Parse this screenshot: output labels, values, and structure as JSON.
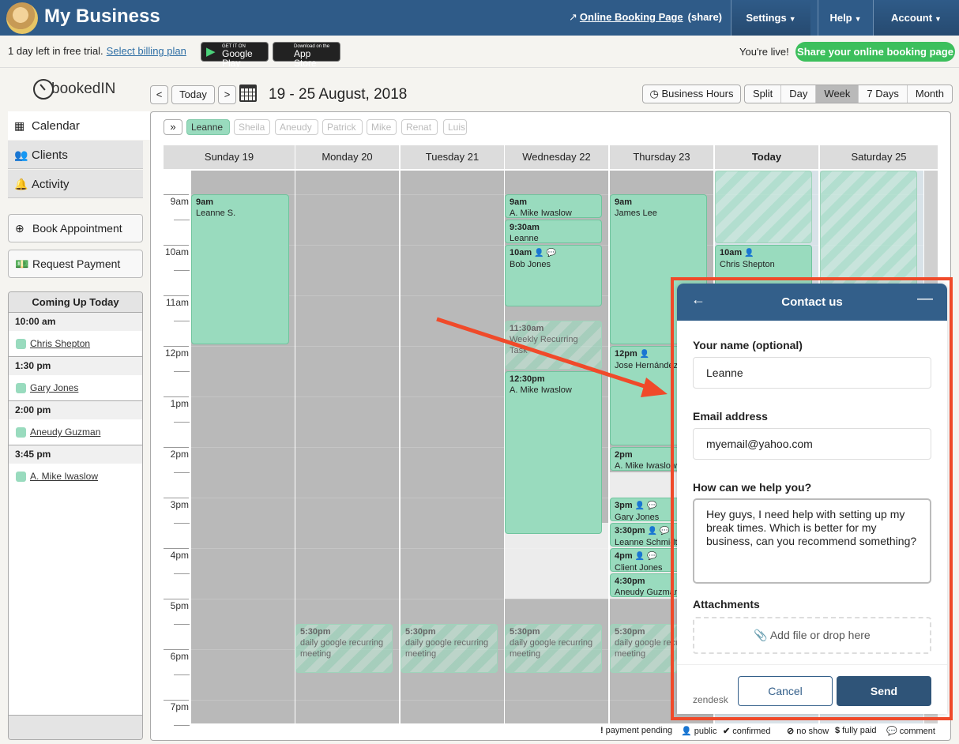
{
  "header": {
    "business_name": "My Business",
    "online_booking_link": "Online Booking Page",
    "share_link": "(share)",
    "nav": [
      {
        "label": "Settings",
        "icon": "caret-down-icon"
      },
      {
        "label": "Help",
        "icon": "caret-down-icon"
      },
      {
        "label": "Account",
        "icon": "caret-down-icon"
      }
    ]
  },
  "trial_bar": {
    "message": "1 day left in free trial.",
    "billing_link": "Select billing plan",
    "google_play": {
      "small": "GET IT ON",
      "big": "Google Play"
    },
    "app_store": {
      "small": "Download on the",
      "big": "App Store"
    },
    "live_text": "You're live!",
    "share_button": "Share your online booking page"
  },
  "toolbar": {
    "logo_text": "bookedIN",
    "prev": "<",
    "today": "Today",
    "next": ">",
    "date_range": "19 - 25 August, 2018",
    "business_hours": "Business Hours",
    "views": [
      "Split",
      "Day",
      "Week",
      "7 Days",
      "Month"
    ],
    "active_view": "Week"
  },
  "sidebar": {
    "nav": [
      {
        "label": "Calendar",
        "icon": "calendar-icon",
        "active": true
      },
      {
        "label": "Clients",
        "icon": "users-icon",
        "active": false
      },
      {
        "label": "Activity",
        "icon": "bell-icon",
        "active": false
      }
    ],
    "book_appointment": "Book Appointment",
    "request_payment": "Request Payment",
    "coming_up": {
      "title": "Coming Up Today",
      "items": [
        {
          "time": "10:00 am",
          "client": "Chris Shepton"
        },
        {
          "time": "1:30 pm",
          "client": "Gary Jones"
        },
        {
          "time": "2:00 pm",
          "client": "Aneudy Guzman"
        },
        {
          "time": "3:45 pm",
          "client": "A. Mike Iwaslow"
        }
      ]
    }
  },
  "calendar": {
    "expand": "»",
    "staff": [
      {
        "name": "Leanne",
        "selected": true
      },
      {
        "name": "Sheila",
        "selected": false
      },
      {
        "name": "Aneudy",
        "selected": false
      },
      {
        "name": "Patrick",
        "selected": false
      },
      {
        "name": "Mike",
        "selected": false
      },
      {
        "name": "Renat",
        "selected": false
      },
      {
        "name": "Luis",
        "selected": false
      }
    ],
    "days": [
      "Sunday 19",
      "Monday 20",
      "Tuesday 21",
      "Wednesday 22",
      "Thursday 23",
      "Today",
      "Saturday 25"
    ],
    "hours": [
      "9am",
      "10am",
      "11am",
      "12pm",
      "1pm",
      "2pm",
      "3pm",
      "4pm",
      "5pm",
      "6pm",
      "7pm"
    ],
    "events": [
      {
        "day": 0,
        "time": "9am",
        "title": "Leanne S.",
        "icons": []
      },
      {
        "day": 3,
        "time": "9am",
        "title": "A. Mike Iwaslow",
        "icons": []
      },
      {
        "day": 3,
        "time": "9:30am",
        "title": "Leanne",
        "icons": []
      },
      {
        "day": 3,
        "time": "10am",
        "title": "Bob Jones",
        "icons": [
          "public",
          "comment"
        ]
      },
      {
        "day": 3,
        "time": "11:30am",
        "title": "Weekly Recurring Task",
        "icons": [],
        "ghost": true
      },
      {
        "day": 3,
        "time": "12:30pm",
        "title": "A. Mike Iwaslow",
        "icons": []
      },
      {
        "day": 4,
        "time": "9am",
        "title": "James Lee",
        "icons": []
      },
      {
        "day": 4,
        "time": "12pm",
        "title": "Jose Hernández",
        "icons": [
          "public"
        ]
      },
      {
        "day": 4,
        "time": "2pm",
        "title": "A. Mike Iwaslow",
        "icons": []
      },
      {
        "day": 4,
        "time": "3pm",
        "title": "Gary Jones",
        "icons": [
          "public",
          "comment"
        ]
      },
      {
        "day": 4,
        "time": "3:30pm",
        "title": "Leanne Schmidt",
        "icons": [
          "public",
          "comment"
        ]
      },
      {
        "day": 4,
        "time": "4pm",
        "title": "Client Jones",
        "icons": [
          "public",
          "comment"
        ]
      },
      {
        "day": 4,
        "time": "4:30pm",
        "title": "Aneudy Guzman",
        "icons": []
      },
      {
        "day": 5,
        "time": "10am",
        "title": "Chris Shepton",
        "icons": [
          "public"
        ]
      },
      {
        "day": 1,
        "time": "5:30pm",
        "title": "daily google recurring meeting",
        "icons": [],
        "ghost": true
      },
      {
        "day": 2,
        "time": "5:30pm",
        "title": "daily google recurring meeting",
        "icons": [],
        "ghost": true
      },
      {
        "day": 3,
        "time": "5:30pm",
        "title": "daily google recurring meeting",
        "icons": [],
        "ghost": true
      },
      {
        "day": 4,
        "time": "5:30pm",
        "title": "daily google recurring meeting",
        "icons": [],
        "ghost": true
      }
    ],
    "legend": [
      {
        "icon": "exclamation-icon",
        "glyph": "!",
        "label": "payment pending"
      },
      {
        "icon": "person-icon",
        "glyph": "👤",
        "label": "public"
      },
      {
        "icon": "check-icon",
        "glyph": "✔",
        "label": "confirmed"
      },
      {
        "icon": "no-show-icon",
        "glyph": "⊘",
        "label": "no show"
      },
      {
        "icon": "dollar-icon",
        "glyph": "$",
        "label": "fully paid"
      },
      {
        "icon": "comment-icon",
        "glyph": "💬",
        "label": "comment"
      }
    ]
  },
  "contact_modal": {
    "title": "Contact us",
    "name_label": "Your name (optional)",
    "name_value": "Leanne",
    "email_label": "Email address",
    "email_value": "myemail@yahoo.com",
    "help_label": "How can we help you?",
    "help_value": "Hey guys, I need help with setting up my break times. Which is better for my business, can you recommend something?",
    "attachments_label": "Attachments",
    "attach_placeholder": "Add file or drop here",
    "brand": "zendesk",
    "cancel": "Cancel",
    "send": "Send"
  },
  "colors": {
    "brand_blue": "#2f5b88",
    "event_green": "#99dbbe",
    "share_green": "#3cbf5c",
    "annotation_red": "#f04a2a"
  }
}
